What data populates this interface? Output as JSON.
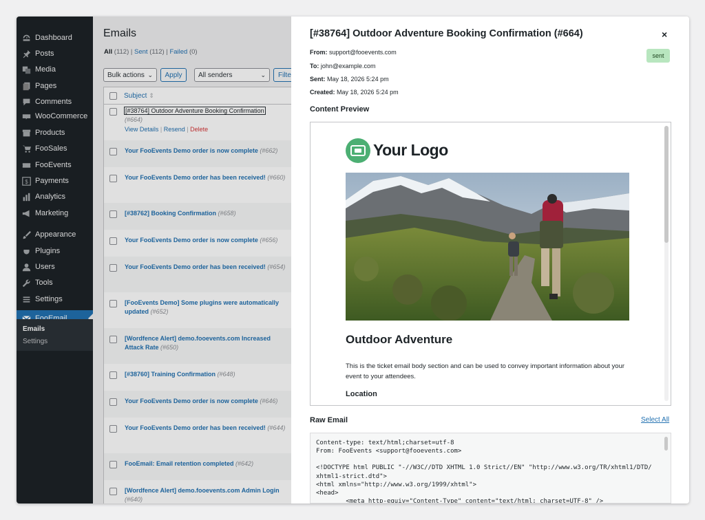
{
  "sidebar": {
    "items": [
      {
        "label": "Dashboard",
        "icon": "dashboard-icon"
      },
      {
        "label": "Posts",
        "icon": "pin-icon"
      },
      {
        "label": "Media",
        "icon": "media-icon"
      },
      {
        "label": "Pages",
        "icon": "pages-icon"
      },
      {
        "label": "Comments",
        "icon": "comment-icon"
      },
      {
        "label": "WooCommerce",
        "icon": "woo-icon"
      },
      {
        "label": "Products",
        "icon": "archive-icon"
      },
      {
        "label": "FooSales",
        "icon": "cart-icon"
      },
      {
        "label": "FooEvents",
        "icon": "ticket-icon"
      },
      {
        "label": "Payments",
        "icon": "dollar-icon"
      },
      {
        "label": "Analytics",
        "icon": "bar-chart-icon"
      },
      {
        "label": "Marketing",
        "icon": "megaphone-icon"
      },
      {
        "label": "Appearance",
        "icon": "brush-icon"
      },
      {
        "label": "Plugins",
        "icon": "plug-icon"
      },
      {
        "label": "Users",
        "icon": "user-icon"
      },
      {
        "label": "Tools",
        "icon": "wrench-icon"
      },
      {
        "label": "Settings",
        "icon": "settings-icon"
      },
      {
        "label": "FooEmail",
        "icon": "mail-icon"
      }
    ],
    "submenu": [
      "Emails",
      "Settings"
    ]
  },
  "list": {
    "title": "Emails",
    "filters": {
      "all_label": "All",
      "all_count": "(112)",
      "sent_label": "Sent",
      "sent_count": "(112)",
      "failed_label": "Failed",
      "failed_count": "(0)"
    },
    "bulk_actions": "Bulk actions",
    "apply": "Apply",
    "senders": "All senders",
    "filter": "Filter",
    "column_subject": "Subject",
    "rows": [
      {
        "subject": "[#38764] Outdoor Adventure Booking Confirmation",
        "num": "(#664)",
        "actions": [
          "View Details",
          "Resend",
          "Delete"
        ]
      },
      {
        "subject": "Your FooEvents Demo order is now complete",
        "num": "(#662)"
      },
      {
        "subject": "Your FooEvents Demo order has been received!",
        "num": "(#660)"
      },
      {
        "subject": "[#38762] Booking Confirmation",
        "num": "(#658)"
      },
      {
        "subject": "Your FooEvents Demo order is now complete",
        "num": "(#656)"
      },
      {
        "subject": "Your FooEvents Demo order has been received!",
        "num": "(#654)"
      },
      {
        "subject": "[FooEvents Demo] Some plugins were automatically updated",
        "num": "(#652)"
      },
      {
        "subject": "[Wordfence Alert] demo.fooevents.com Increased Attack Rate",
        "num": "(#650)"
      },
      {
        "subject": "[#38760] Training Confirmation",
        "num": "(#648)"
      },
      {
        "subject": "Your FooEvents Demo order is now complete",
        "num": "(#646)"
      },
      {
        "subject": "Your FooEvents Demo order has been received!",
        "num": "(#644)"
      },
      {
        "subject": "FooEmail: Email retention completed",
        "num": "(#642)"
      },
      {
        "subject": "[Wordfence Alert] demo.fooevents.com Admin Login",
        "num": "(#640)"
      }
    ]
  },
  "panel": {
    "title": "[#38764] Outdoor Adventure Booking Confirmation (#664)",
    "close": "×",
    "from_label": "From:",
    "from": "support@fooevents.com",
    "to_label": "To:",
    "to": "john@example.com",
    "sent_label": "Sent:",
    "sent": "May 18, 2026 5:24 pm",
    "created_label": "Created:",
    "created": "May 18, 2026 5:24 pm",
    "status": "sent",
    "content_preview": "Content Preview",
    "email": {
      "logo_text": "Your Logo",
      "heading": "Outdoor Adventure",
      "body": "This is the ticket email body section and can be used to convey important information about your event to your attendees.",
      "location": "Location"
    },
    "raw_email": "Raw Email",
    "select_all": "Select All",
    "raw_lines": [
      "Content-type: text/html;charset=utf-8",
      "From: FooEvents <support@fooevents.com>",
      "",
      "<!DOCTYPE html PUBLIC \"-//W3C//DTD XHTML 1.0 Strict//EN\" \"http://www.w3.org/TR/xhtml1/DTD/",
      "xhtml1-strict.dtd\">",
      "<html xmlns=\"http://www.w3.org/1999/xhtml\">",
      "<head>",
      "        <meta http-equiv=\"Content-Type\" content=\"text/html; charset=UTF-8\" />"
    ]
  },
  "colors": {
    "sidebar_bg": "#1d2327",
    "accent": "#2271b1",
    "delete": "#d63638",
    "badge_bg": "#b8e6bf",
    "logo_green": "#4caf73"
  }
}
